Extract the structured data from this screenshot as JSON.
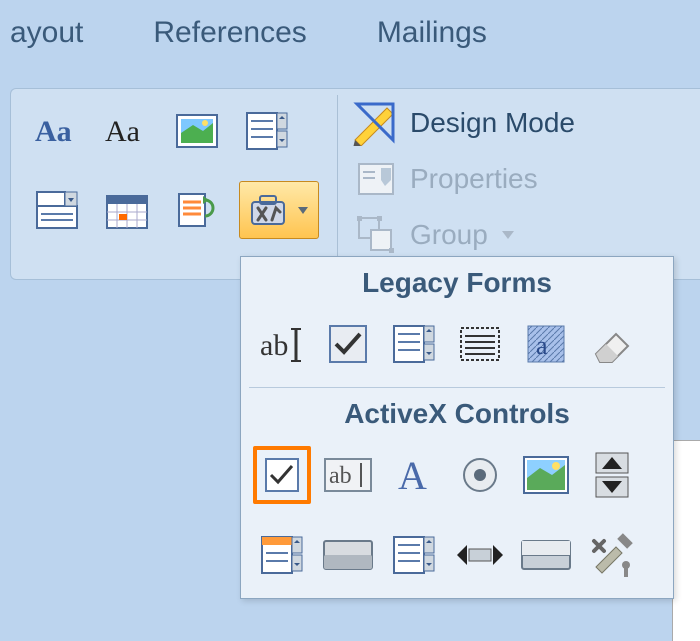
{
  "tabs": {
    "layout": "ayout",
    "references": "References",
    "mailings": "Mailings"
  },
  "right": {
    "design_mode": "Design Mode",
    "properties": "Properties",
    "group": "Group"
  },
  "dropdown": {
    "legacy_header": "Legacy Forms",
    "activex_header": "ActiveX Controls"
  }
}
